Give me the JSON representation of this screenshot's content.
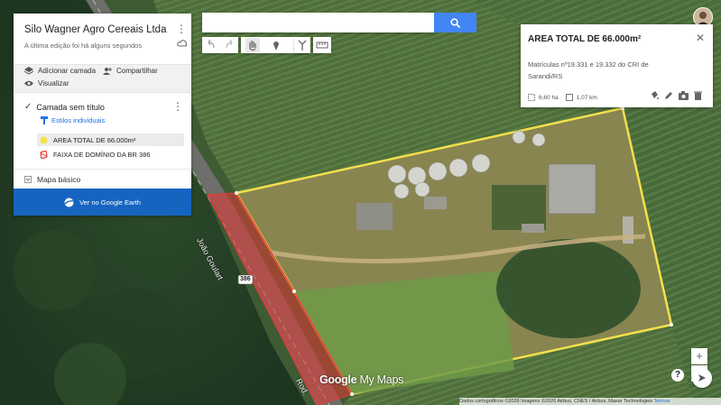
{
  "map": {
    "title": "Silo Wagner Agro Cereais Ltda",
    "last_edit": "A última edição foi há alguns segundos",
    "actions": {
      "add_layer": "Adicionar camada",
      "share": "Compartilhar",
      "preview": "Visualizar"
    },
    "layer": {
      "name": "Camada sem título",
      "styles": "Estilos individuais",
      "features": [
        {
          "label": "AREA TOTAL DE 66.000m²",
          "color": "#f4e04d"
        },
        {
          "label": "FAIXA DE DOMÍNIO DA BR 386",
          "color": "#e53935"
        }
      ]
    },
    "base_map": "Mapa básico",
    "earth_button": "Ver no Google Earth"
  },
  "search": {
    "value": "",
    "placeholder": ""
  },
  "toolbar": {
    "icons": [
      "undo-icon",
      "redo-icon",
      "hand-icon",
      "marker-icon",
      "draw-line-icon",
      "directions-icon",
      "ruler-icon"
    ]
  },
  "info_window": {
    "title": "AREA TOTAL DE 66.000m²",
    "description": "Matrículas nº19.331 e 19.332 do CRI de Sarandi/RS",
    "area": "6,60 ha",
    "perimeter": "1,07 km"
  },
  "map_labels": {
    "road_name_1": "João Goulart",
    "road_name_2": "Rod.",
    "route_shield": "386"
  },
  "controls": {
    "zoom_in": "+",
    "zoom_out": "−",
    "help": "?"
  },
  "logo": {
    "google": "Google",
    "mymaps": " My Maps"
  },
  "attribution": {
    "text": "Dados cartográficos ©2026 Imagens ©2026 Airbus, CNES / Airbus, Maxar Technologies",
    "terms": "Termos"
  },
  "colors": {
    "accent": "#4285f4",
    "earth_button": "#1565c0",
    "polygon_yellow": "#f4e04d",
    "polygon_red": "#e53935"
  }
}
